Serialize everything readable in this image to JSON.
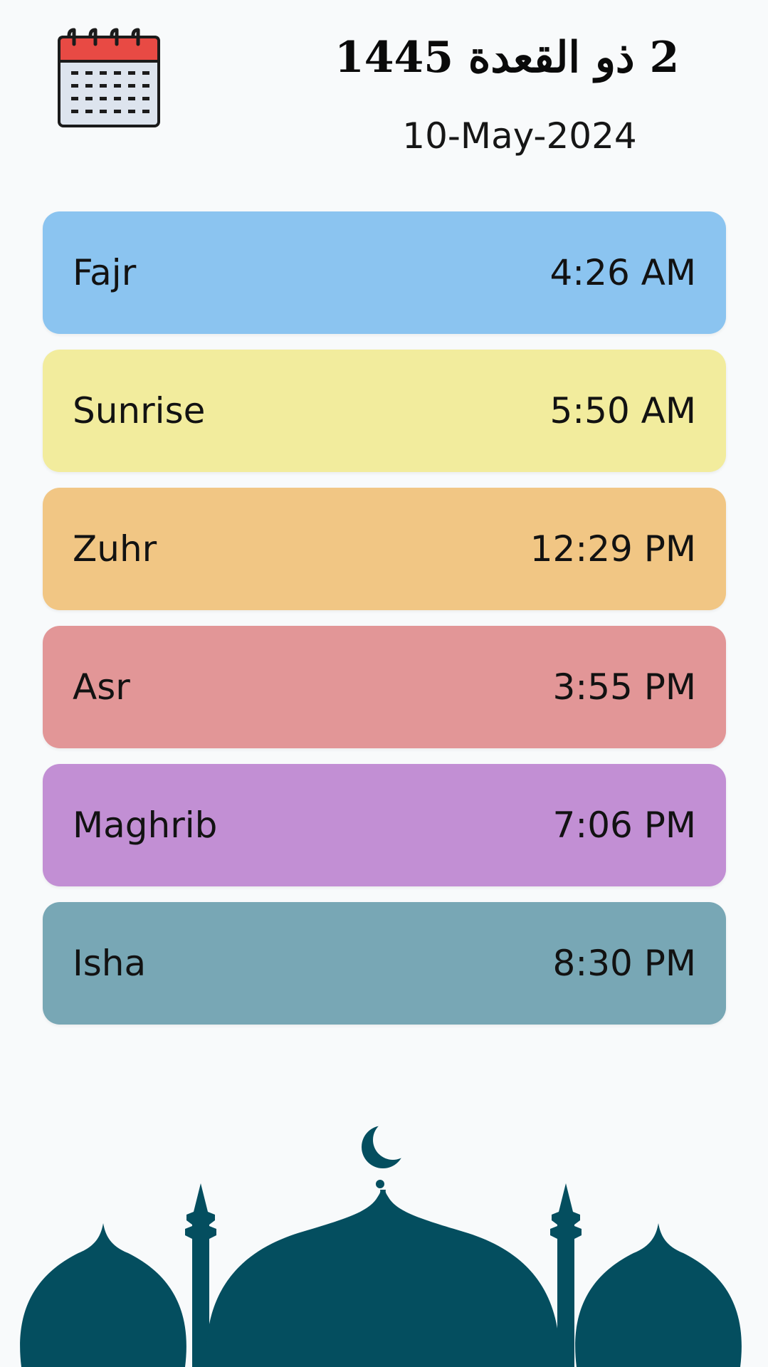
{
  "header": {
    "hijri_date": "2 ذو القعدة 1445",
    "gregorian_date": "10-May-2024",
    "calendar_icon": "calendar-icon"
  },
  "prayers": [
    {
      "name": "Fajr",
      "time": "4:26 AM",
      "color": "#8bc4f0"
    },
    {
      "name": "Sunrise",
      "time": "5:50 AM",
      "color": "#f2ec9d"
    },
    {
      "name": "Zuhr",
      "time": "12:29 PM",
      "color": "#f1c684"
    },
    {
      "name": "Asr",
      "time": "3:55 PM",
      "color": "#e29697"
    },
    {
      "name": "Maghrib",
      "time": "7:06 PM",
      "color": "#c28fd4"
    },
    {
      "name": "Isha",
      "time": "8:30 PM",
      "color": "#78a7b5"
    }
  ],
  "colors": {
    "background": "#f8fafb",
    "mosque": "#044e5f",
    "calendar_red": "#e84a44",
    "calendar_body": "#dde4ee"
  },
  "decor": {
    "mosque_icon": "mosque-silhouette-icon",
    "crescent_icon": "crescent-icon"
  }
}
